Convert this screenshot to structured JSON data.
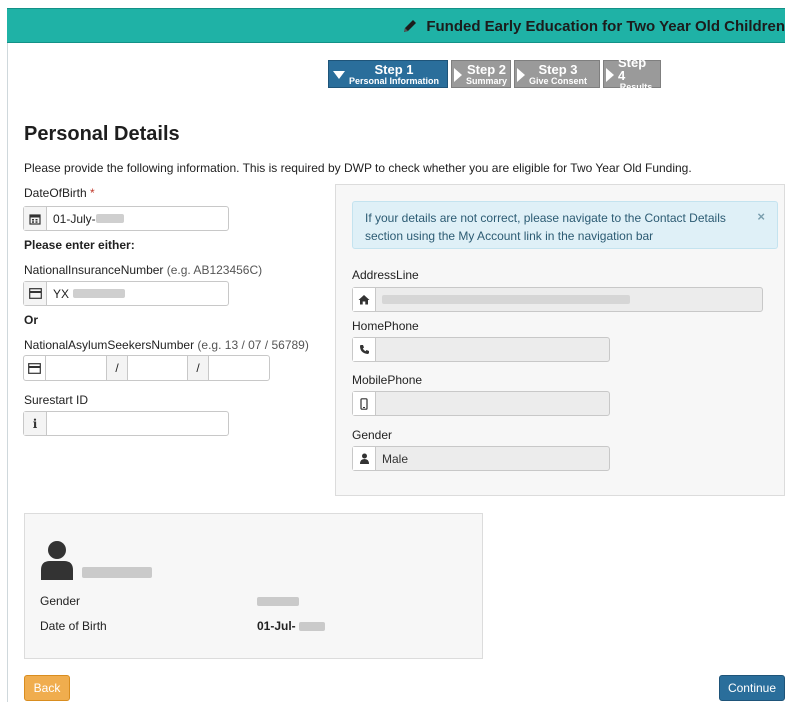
{
  "header": {
    "title": "Funded Early Education for Two Year Old Children",
    "icon": "pencil-icon"
  },
  "stepper": {
    "steps": [
      {
        "num": "Step 1",
        "sub": "Personal Information"
      },
      {
        "num": "Step 2",
        "sub": "Summary"
      },
      {
        "num": "Step 3",
        "sub": "Give Consent"
      },
      {
        "num": "Step 4",
        "sub": "Results"
      }
    ]
  },
  "form": {
    "title": "Personal Details",
    "intro": "Please provide the following information. This is required by DWP to check whether you are eligible for Two Year Old Funding.",
    "dob_label": "DateOfBirth",
    "required_mark": "*",
    "dob_value": "01-July-",
    "enter_either": "Please enter either:",
    "nin_label": "NationalInsuranceNumber",
    "nin_hint": "(e.g. AB123456C)",
    "nin_value": "YX",
    "or_label": "Or",
    "nasn_label": "NationalAsylumSeekersNumber",
    "nasn_hint": "(e.g. 13 / 07 / 56789)",
    "nasn_sep1": "/",
    "nasn_sep2": "/",
    "surestart_label": "Surestart ID",
    "surestart_value": ""
  },
  "contact": {
    "alert": "If your details are not correct, please navigate to the Contact Details section using the My Account link in the navigation bar",
    "alert_close": "×",
    "address_label": "AddressLine",
    "home_label": "HomePhone",
    "mobile_label": "MobilePhone",
    "gender_label": "Gender",
    "gender_value": "Male"
  },
  "summary": {
    "gender_label": "Gender",
    "dob_label": "Date of Birth",
    "dob_value": "01-Jul-"
  },
  "buttons": {
    "back": "Back",
    "continue": "Continue"
  },
  "colors": {
    "header": "#1fb2a6",
    "primary": "#2a6e9b",
    "back": "#f0ad4e",
    "alert_bg": "#dff0f7"
  }
}
